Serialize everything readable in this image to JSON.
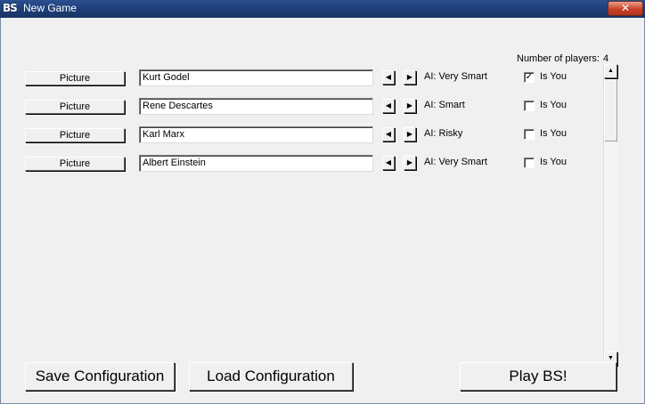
{
  "window": {
    "icon_text": "BS",
    "title": "New Game",
    "close_label": "✕"
  },
  "num_players": {
    "label": "Number of players:",
    "value": "4"
  },
  "players": [
    {
      "picture_label": "Picture",
      "name": "Kurt Godel",
      "ai": "AI: Very Smart",
      "is_you_label": "Is You",
      "is_you": true
    },
    {
      "picture_label": "Picture",
      "name": "Rene Descartes",
      "ai": "AI: Smart",
      "is_you_label": "Is You",
      "is_you": false
    },
    {
      "picture_label": "Picture",
      "name": "Karl Marx",
      "ai": "AI: Risky",
      "is_you_label": "Is You",
      "is_you": false
    },
    {
      "picture_label": "Picture",
      "name": "Albert Einstein",
      "ai": "AI: Very Smart",
      "is_you_label": "Is You",
      "is_you": false
    }
  ],
  "spinner": {
    "left": "◀",
    "right": "▶"
  },
  "scrollbar": {
    "up": "▲",
    "down": "▼"
  },
  "buttons": {
    "save": "Save Configuration",
    "load": "Load Configuration",
    "play": "Play BS!"
  }
}
